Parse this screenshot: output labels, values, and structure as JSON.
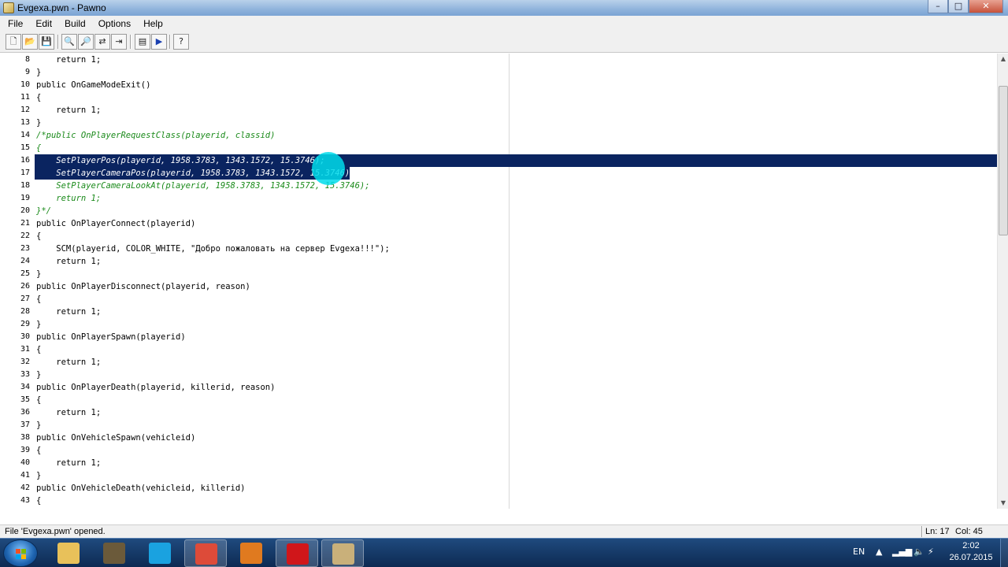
{
  "window": {
    "title": "Evgexa.pwn - Pawno",
    "controls": {
      "minimize": "–",
      "maximize": "□",
      "close": "✕"
    }
  },
  "menu": [
    "File",
    "Edit",
    "Build",
    "Options",
    "Help"
  ],
  "toolbar": [
    {
      "name": "new-file-icon",
      "glyph": "🗋"
    },
    {
      "name": "open-folder-icon",
      "glyph": "📂"
    },
    {
      "name": "save-icon",
      "glyph": "💾"
    },
    {
      "name": "find-icon",
      "glyph": "🔍"
    },
    {
      "name": "find-next-icon",
      "glyph": "🔎"
    },
    {
      "name": "replace-icon",
      "glyph": "⇄"
    },
    {
      "name": "goto-line-icon",
      "glyph": "⇥"
    },
    {
      "name": "function-list-icon",
      "glyph": "▤"
    },
    {
      "name": "compile-run-icon",
      "glyph": "▶"
    },
    {
      "name": "help-icon",
      "glyph": "?"
    }
  ],
  "editor": {
    "selected_lines": [
      16,
      17
    ],
    "lines": [
      {
        "n": "8",
        "t": "    return 1;",
        "s": ""
      },
      {
        "n": "9",
        "t": "}",
        "s": ""
      },
      {
        "n": "10",
        "t": "public OnGameModeExit()",
        "s": ""
      },
      {
        "n": "11",
        "t": "{",
        "s": ""
      },
      {
        "n": "12",
        "t": "    return 1;",
        "s": ""
      },
      {
        "n": "13",
        "t": "}",
        "s": ""
      },
      {
        "n": "14",
        "t": "/*public OnPlayerRequestClass(playerid, classid)",
        "s": "comment"
      },
      {
        "n": "15",
        "t": "{",
        "s": "comment"
      },
      {
        "n": "16",
        "t": "    SetPlayerPos(playerid, 1958.3783, 1343.1572, 15.3746);",
        "s": "comment sel-full"
      },
      {
        "n": "17",
        "t": "    SetPlayerCameraPos(playerid, 1958.3783, 1343.1572, 15.3746);",
        "s": "comment sel-partial"
      },
      {
        "n": "18",
        "t": "    SetPlayerCameraLookAt(playerid, 1958.3783, 1343.1572, 15.3746);",
        "s": "comment"
      },
      {
        "n": "19",
        "t": "    return 1;",
        "s": "comment"
      },
      {
        "n": "20",
        "t": "}*/",
        "s": "comment"
      },
      {
        "n": "21",
        "t": "public OnPlayerConnect(playerid)",
        "s": ""
      },
      {
        "n": "22",
        "t": "{",
        "s": ""
      },
      {
        "n": "23",
        "t": "    SCM(playerid, COLOR_WHITE, \"Добро пожаловать на сервер Evgexa!!!\");",
        "s": ""
      },
      {
        "n": "24",
        "t": "    return 1;",
        "s": ""
      },
      {
        "n": "25",
        "t": "}",
        "s": ""
      },
      {
        "n": "26",
        "t": "public OnPlayerDisconnect(playerid, reason)",
        "s": ""
      },
      {
        "n": "27",
        "t": "{",
        "s": ""
      },
      {
        "n": "28",
        "t": "    return 1;",
        "s": ""
      },
      {
        "n": "29",
        "t": "}",
        "s": ""
      },
      {
        "n": "30",
        "t": "public OnPlayerSpawn(playerid)",
        "s": ""
      },
      {
        "n": "31",
        "t": "{",
        "s": ""
      },
      {
        "n": "32",
        "t": "    return 1;",
        "s": ""
      },
      {
        "n": "33",
        "t": "}",
        "s": ""
      },
      {
        "n": "34",
        "t": "public OnPlayerDeath(playerid, killerid, reason)",
        "s": ""
      },
      {
        "n": "35",
        "t": "{",
        "s": ""
      },
      {
        "n": "36",
        "t": "    return 1;",
        "s": ""
      },
      {
        "n": "37",
        "t": "}",
        "s": ""
      },
      {
        "n": "38",
        "t": "public OnVehicleSpawn(vehicleid)",
        "s": ""
      },
      {
        "n": "39",
        "t": "{",
        "s": ""
      },
      {
        "n": "40",
        "t": "    return 1;",
        "s": ""
      },
      {
        "n": "41",
        "t": "}",
        "s": ""
      },
      {
        "n": "42",
        "t": "public OnVehicleDeath(vehicleid, killerid)",
        "s": ""
      },
      {
        "n": "43",
        "t": "{",
        "s": ""
      }
    ]
  },
  "status": {
    "message": "File 'Evgexa.pwn' opened.",
    "line": "Ln: 17",
    "col": "Col: 45"
  },
  "taskbar": {
    "apps": [
      {
        "name": "explorer-icon",
        "color": "#e8c15a",
        "active": false
      },
      {
        "name": "gta-sa-icon",
        "color": "#6b5a3a",
        "active": false
      },
      {
        "name": "skype-icon",
        "color": "#1aa2e0",
        "active": false
      },
      {
        "name": "chrome-icon",
        "color": "#dd4b39",
        "active": true
      },
      {
        "name": "pdf-reader-icon",
        "color": "#e07a1f",
        "active": false
      },
      {
        "name": "screen-recorder-icon",
        "color": "#d0161a",
        "active": true
      },
      {
        "name": "pawno-icon",
        "color": "#c9b07a",
        "active": true
      }
    ],
    "language": "EN",
    "time": "2:02",
    "date": "26.07.2015"
  }
}
